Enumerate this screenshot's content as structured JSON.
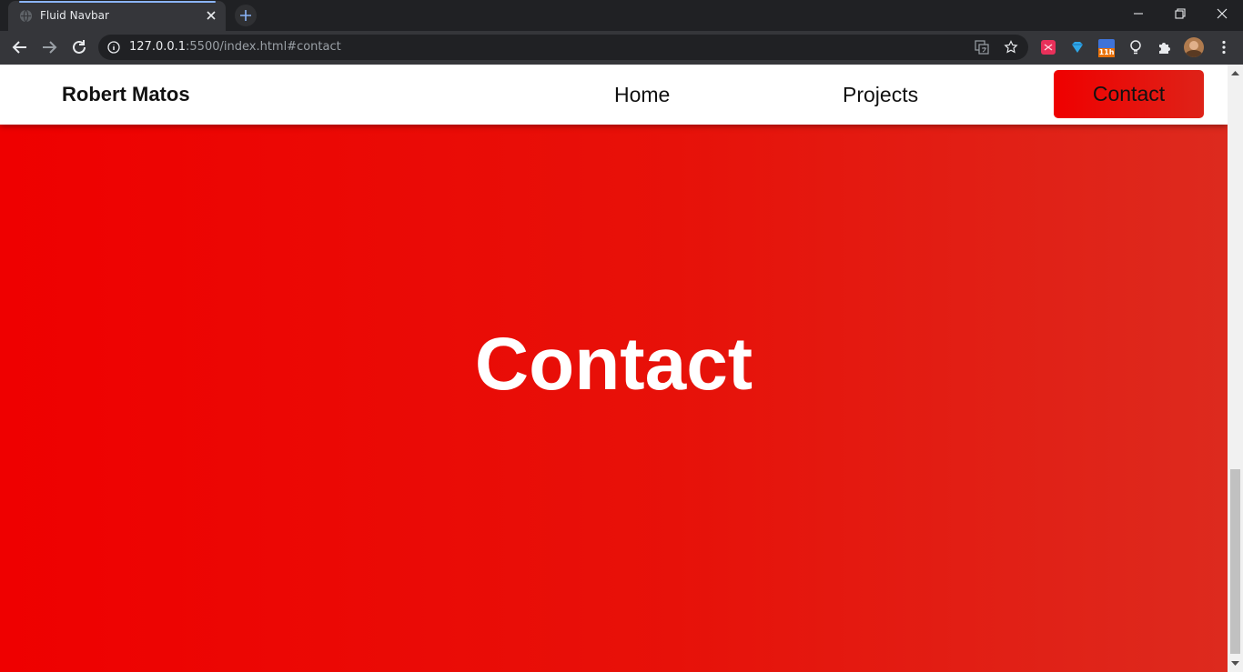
{
  "browser": {
    "tab_title": "Fluid Navbar",
    "url_host": "127.0.0.1",
    "url_rest": ":5500/index.html#contact",
    "extension_badge": "11h",
    "icons": [
      "globe-icon",
      "close-icon",
      "plus-icon",
      "minimize-icon",
      "restore-icon",
      "window-close-icon",
      "back-icon",
      "forward-icon",
      "reload-icon",
      "info-icon",
      "translate-icon",
      "star-icon",
      "extension-icon",
      "puzzle-icon",
      "avatar",
      "kebab-menu-icon"
    ]
  },
  "navbar": {
    "brand": "Robert Matos",
    "links": [
      "Home",
      "Projects"
    ],
    "active_link": "Contact"
  },
  "hero": {
    "title": "Contact"
  },
  "colors": {
    "hero_gradient_start": "#ef0000",
    "hero_gradient_end": "#dd2a1e",
    "navbar_bg": "#ffffff",
    "brand_text": "#111111"
  }
}
